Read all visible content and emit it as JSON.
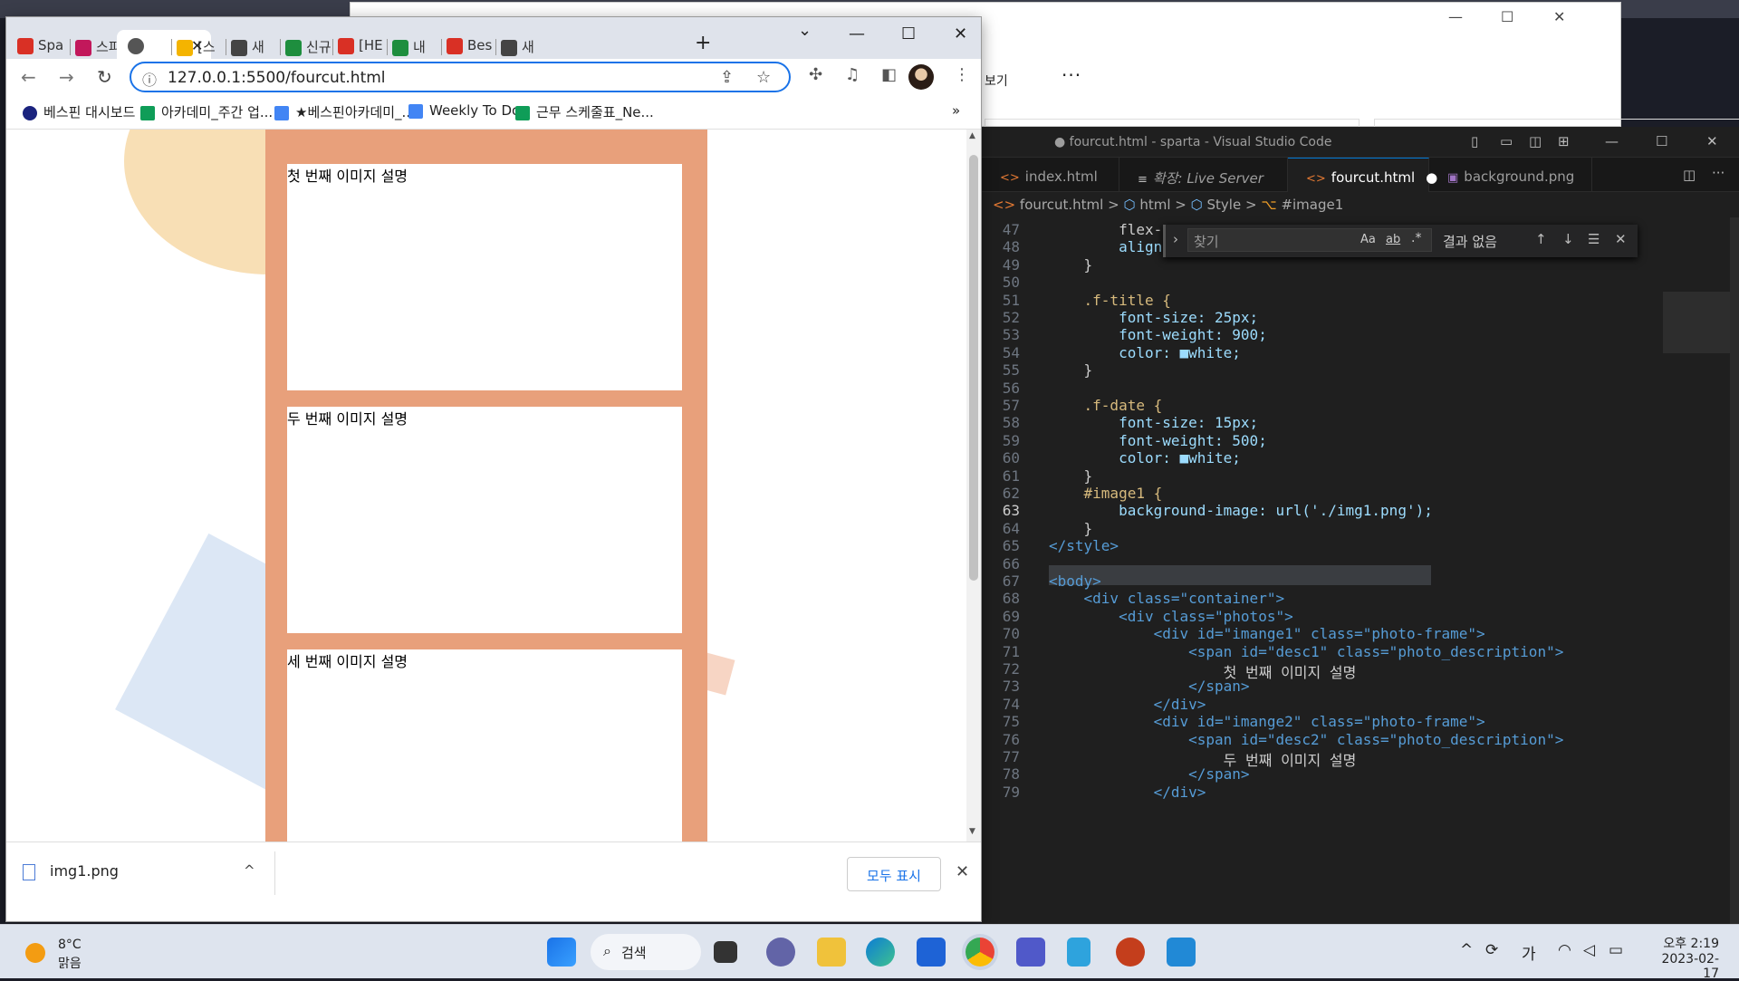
{
  "explorer": {
    "menu_label": "보기",
    "more": "···",
    "min": "—",
    "max": "☐",
    "close": "✕"
  },
  "vscode": {
    "title": "● fourcut.html - sparta - Visual Studio Code",
    "tabs": [
      {
        "label": "index.html"
      },
      {
        "label": "확장: Live Server"
      },
      {
        "label": "fourcut.html"
      },
      {
        "label": "background.png"
      }
    ],
    "breadcrumb": [
      "fourcut.html",
      ">",
      "html",
      ">",
      "Style",
      ">",
      "#image1"
    ],
    "find": {
      "placeholder": "찾기",
      "result": "결과 없음",
      "aa": "Aa",
      "ab": "ab",
      "re": ".*"
    },
    "lines": [
      {
        "n": "47",
        "t": "        flex-"
      },
      {
        "n": "48",
        "t": "        align-items: center;"
      },
      {
        "n": "49",
        "t": "    }"
      },
      {
        "n": "50",
        "t": ""
      },
      {
        "n": "51",
        "t": "    .f-title {"
      },
      {
        "n": "52",
        "t": "        font-size: 25px;"
      },
      {
        "n": "53",
        "t": "        font-weight: 900;"
      },
      {
        "n": "54",
        "t": "        color: ■white;"
      },
      {
        "n": "55",
        "t": "    }"
      },
      {
        "n": "56",
        "t": ""
      },
      {
        "n": "57",
        "t": "    .f-date {"
      },
      {
        "n": "58",
        "t": "        font-size: 15px;"
      },
      {
        "n": "59",
        "t": "        font-weight: 500;"
      },
      {
        "n": "60",
        "t": "        color: ■white;"
      },
      {
        "n": "61",
        "t": "    }"
      },
      {
        "n": "62",
        "t": "    #image1 {"
      },
      {
        "n": "63",
        "t": "        background-image: url('./img1.png');"
      },
      {
        "n": "64",
        "t": "    }"
      },
      {
        "n": "65",
        "t": "</style>"
      },
      {
        "n": "66",
        "t": ""
      },
      {
        "n": "67",
        "t": "<body>"
      },
      {
        "n": "68",
        "t": "    <div class=\"container\">"
      },
      {
        "n": "69",
        "t": "        <div class=\"photos\">"
      },
      {
        "n": "70",
        "t": "            <div id=\"imange1\" class=\"photo-frame\">"
      },
      {
        "n": "71",
        "t": "                <span id=\"desc1\" class=\"photo_description\">"
      },
      {
        "n": "72",
        "t": "                    첫 번째 이미지 설명"
      },
      {
        "n": "73",
        "t": "                </span>"
      },
      {
        "n": "74",
        "t": "            </div>"
      },
      {
        "n": "75",
        "t": "            <div id=\"imange2\" class=\"photo-frame\">"
      },
      {
        "n": "76",
        "t": "                <span id=\"desc2\" class=\"photo_description\">"
      },
      {
        "n": "77",
        "t": "                    두 번째 이미지 설명"
      },
      {
        "n": "78",
        "t": "                </span>"
      },
      {
        "n": "79",
        "t": "            </div>"
      }
    ]
  },
  "chrome": {
    "tabs": [
      {
        "label": "Spa",
        "color": "#d93025"
      },
      {
        "label": "스피",
        "color": "#c2185b"
      },
      {
        "label": "",
        "color": "#555"
      },
      {
        "label": "[스",
        "color": "#f4b400"
      },
      {
        "label": "새",
        "color": "#444"
      },
      {
        "label": "신규",
        "color": "#1e8e3e"
      },
      {
        "label": "[HE",
        "color": "#d93025"
      },
      {
        "label": "내",
        "color": "#1e8e3e"
      },
      {
        "label": "Bes",
        "color": "#d93025"
      },
      {
        "label": "새",
        "color": "#444"
      }
    ],
    "close_tab": "✕",
    "new_tab": "+",
    "dropdown": "⌄",
    "min": "—",
    "max": "☐",
    "close": "✕",
    "url": "127.0.0.1:5500/fourcut.html",
    "bookmarks": [
      {
        "label": "베스핀 대시보드",
        "color": "#1a237e"
      },
      {
        "label": "아카데미_주간 업...",
        "color": "#0f9d58"
      },
      {
        "label": "★베스핀아카데미_...",
        "color": "#4285f4"
      },
      {
        "label": "Weekly To Do",
        "color": "#4285f4"
      },
      {
        "label": "근무 스케줄표_Ne...",
        "color": "#0f9d58"
      }
    ],
    "bookmarks_more": "»",
    "photos": [
      {
        "desc": "첫 번째 이미지 설명"
      },
      {
        "desc": "두 번째 이미지 설명"
      },
      {
        "desc": "세 번째 이미지 설명"
      }
    ],
    "download": {
      "file": "img1.png",
      "show_all": "모두 표시",
      "close": "✕",
      "chevron": "^"
    }
  },
  "taskbar": {
    "temp": "8°C",
    "condition": "맑음",
    "search": "검색",
    "time": "오후 2:19",
    "date": "2023-02-17",
    "ime": "가"
  }
}
